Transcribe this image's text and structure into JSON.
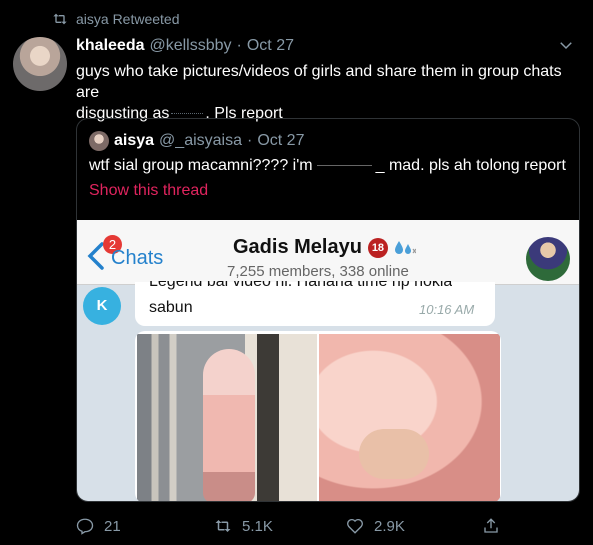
{
  "retweet": {
    "label": "aisya Retweeted"
  },
  "tweet": {
    "author_name": "khaleeda",
    "handle": "@kellssbby",
    "separator": "·",
    "date": "Oct 27",
    "text_line1": "guys who take pictures/videos of girls and share them in group chats are",
    "text_line2a": "disgusting as",
    "text_line2b": ". Pls report"
  },
  "quote": {
    "author_name": "aisya",
    "handle": "@_aisyaisa",
    "separator": "·",
    "date": "Oct 27",
    "text_a": "wtf sial group macamni???? i'm",
    "text_b": "_ mad. pls ah tolong report",
    "show_thread": "Show this thread"
  },
  "telegram": {
    "badge_count": "2",
    "back_label": "Chats",
    "group_title": "Gadis Melayu",
    "rating_badge": "18",
    "subtitle": "7,255 members, 338 online",
    "sender_initial": "K",
    "cut_text": "Legend bai video ni. Hahaha time hp nokia",
    "message_text": "sabun",
    "message_time": "10:16 AM"
  },
  "actions": {
    "replies": "21",
    "retweets": "5.1K",
    "likes": "2.9K"
  },
  "colors": {
    "background": "#000000",
    "muted": "#8899a6",
    "show_thread": "#e0245e",
    "telegram_blue": "#2481cc"
  }
}
